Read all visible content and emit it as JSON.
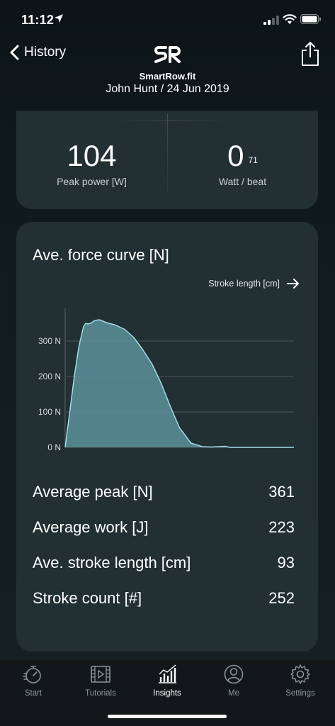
{
  "status_bar": {
    "time": "11:12",
    "location_icon": "location-arrow-icon",
    "signal_icon": "cellular-signal-icon",
    "wifi_icon": "wifi-icon",
    "battery_icon": "battery-icon"
  },
  "nav": {
    "back_label": "History",
    "back_icon": "chevron-left-icon",
    "logo_text": "SR",
    "share_icon": "share-icon",
    "app_name": "SmartRow.fit",
    "subtitle": "John Hunt / 24 Jun 2019"
  },
  "summary": {
    "left": {
      "value": "104",
      "label": "Peak power [W]"
    },
    "right": {
      "value": "0",
      "superscript": "71",
      "label": "Watt / beat"
    }
  },
  "force_card": {
    "title": "Ave. force curve [N]",
    "axis_toggle_label": "Stroke length [cm]",
    "axis_toggle_icon": "arrow-right-icon"
  },
  "chart_data": {
    "type": "area",
    "title": "Ave. force curve [N]",
    "xlabel": "Stroke length [cm]",
    "ylabel": "",
    "ylim": [
      0,
      400
    ],
    "yticks": [
      {
        "value": 0,
        "label": "0 N"
      },
      {
        "value": 100,
        "label": "100 N"
      },
      {
        "value": 200,
        "label": "200 N"
      },
      {
        "value": 300,
        "label": "300 N"
      }
    ],
    "x": [
      0,
      2,
      4,
      6,
      8,
      9,
      10,
      11,
      13,
      15,
      18,
      22,
      26,
      30,
      34,
      38,
      42,
      46,
      50,
      55,
      60,
      64,
      67,
      70,
      72,
      75,
      80,
      90,
      100
    ],
    "values": [
      0,
      100,
      200,
      285,
      340,
      350,
      348,
      350,
      358,
      360,
      352,
      345,
      333,
      310,
      275,
      235,
      180,
      115,
      55,
      12,
      2,
      1,
      2,
      3,
      0,
      0,
      0,
      0,
      0
    ],
    "fill_color": "#5d919a",
    "line_color": "#9fdde8",
    "grid": true
  },
  "stats": [
    {
      "label": "Average peak [N]",
      "value": "361"
    },
    {
      "label": "Average work [J]",
      "value": "223"
    },
    {
      "label": "Ave. stroke length [cm]",
      "value": "93"
    },
    {
      "label": "Stroke count [#]",
      "value": "252"
    }
  ],
  "tabs": [
    {
      "label": "Start",
      "icon": "stopwatch-icon",
      "active": false
    },
    {
      "label": "Tutorials",
      "icon": "film-icon",
      "active": false
    },
    {
      "label": "Insights",
      "icon": "bar-chart-icon",
      "active": true
    },
    {
      "label": "Me",
      "icon": "user-icon",
      "active": false
    },
    {
      "label": "Settings",
      "icon": "gear-icon",
      "active": false
    }
  ]
}
